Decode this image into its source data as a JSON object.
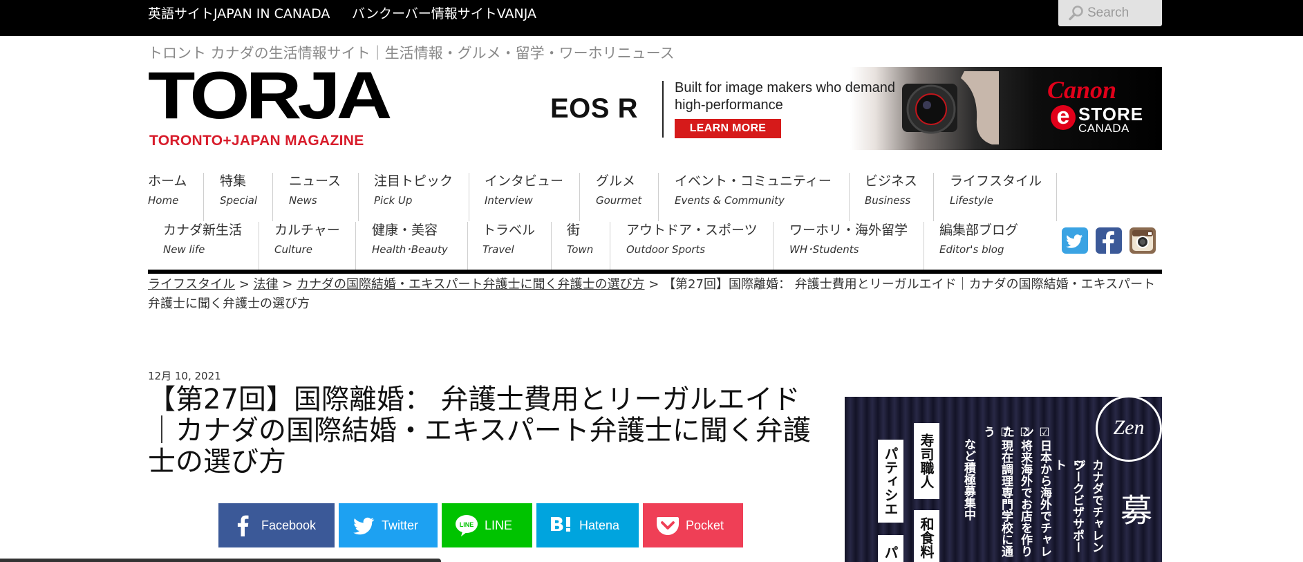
{
  "topbar": {
    "links": [
      "英語サイトJAPAN IN CANADA",
      "バンクーバー情報サイトVANJA"
    ],
    "search_placeholder": "Search"
  },
  "tagline": "トロント カナダの生活情報サイト｜生活情報・グルメ・留学・ワーホリニュース",
  "logo": {
    "word": "TORJA",
    "sub": "TORONTO+JAPAN MAGAZINE"
  },
  "banner": {
    "product": "EOS R",
    "copy": "Built for image makers who demand high-performance",
    "cta": "LEARN MORE",
    "brand": "Canon",
    "store_e": "e",
    "store_name": "STORE",
    "store_country": "CANADA"
  },
  "nav": {
    "row1": [
      {
        "ja": "ホーム",
        "en": "Home"
      },
      {
        "ja": "特集",
        "en": "Special"
      },
      {
        "ja": "ニュース",
        "en": "News"
      },
      {
        "ja": "注目トピック",
        "en": "Pick Up"
      },
      {
        "ja": "インタビュー",
        "en": "Interview"
      },
      {
        "ja": "グルメ",
        "en": "Gourmet"
      },
      {
        "ja": "イベント・コミュニティー",
        "en": "Events & Community"
      },
      {
        "ja": "ビジネス",
        "en": "Business"
      },
      {
        "ja": "ライフスタイル",
        "en": "Lifestyle"
      }
    ],
    "row2": [
      {
        "ja": "カナダ新生活",
        "en": "New life"
      },
      {
        "ja": "カルチャー",
        "en": "Culture"
      },
      {
        "ja": "健康・美容",
        "en": "Health･Beauty"
      },
      {
        "ja": "トラベル",
        "en": "Travel"
      },
      {
        "ja": "街",
        "en": "Town"
      },
      {
        "ja": "アウトドア・スポーツ",
        "en": "Outdoor Sports"
      },
      {
        "ja": "ワーホリ・海外留学",
        "en": "WH･Students"
      },
      {
        "ja": "編集部ブログ",
        "en": "Editor's blog"
      }
    ],
    "social_colors": {
      "twitter": "#3aa3e3",
      "facebook": "#3b5998",
      "instagram": "#8a6a4f"
    }
  },
  "breadcrumb": {
    "items": [
      "ライフスタイル",
      "法律",
      "カナダの国際結婚・エキスパート弁護士に聞く弁護士の選び方"
    ],
    "separator": " > ",
    "current": "【第27回】国際離婚： 弁護士費用とリーガルエイド｜カナダの国際結婚・エキスパート弁護士に聞く弁護士の選び方"
  },
  "article": {
    "date": "12月 10, 2021",
    "title": "【第27回】国際離婚： 弁護士費用とリーガルエイド｜カナダの国際結婚・エキスパート弁護士に聞く弁護士の選び方"
  },
  "share": [
    {
      "label": "Facebook",
      "color": "#3b5998"
    },
    {
      "label": "Twitter",
      "color": "#1da1f2"
    },
    {
      "label": "LINE",
      "color": "#00c300"
    },
    {
      "label": "Hatena",
      "color": "#00a4de"
    },
    {
      "label": "Pocket",
      "color": "#ef3f56"
    }
  ],
  "sidead": {
    "logo": "Zen",
    "col1": "パティシエ",
    "col2": "寿司職人",
    "col3": "和食料",
    "col4": "パ",
    "text1": "☑日本から海外でチャレン",
    "text2": "☑将来海外でお店を作りた",
    "text3": "☑現在調理専門学校に通う",
    "text4": "など積極募集中",
    "text5": "カナダでチャレンジ",
    "text6": "ワークビザサポート",
    "big": "人材募"
  }
}
